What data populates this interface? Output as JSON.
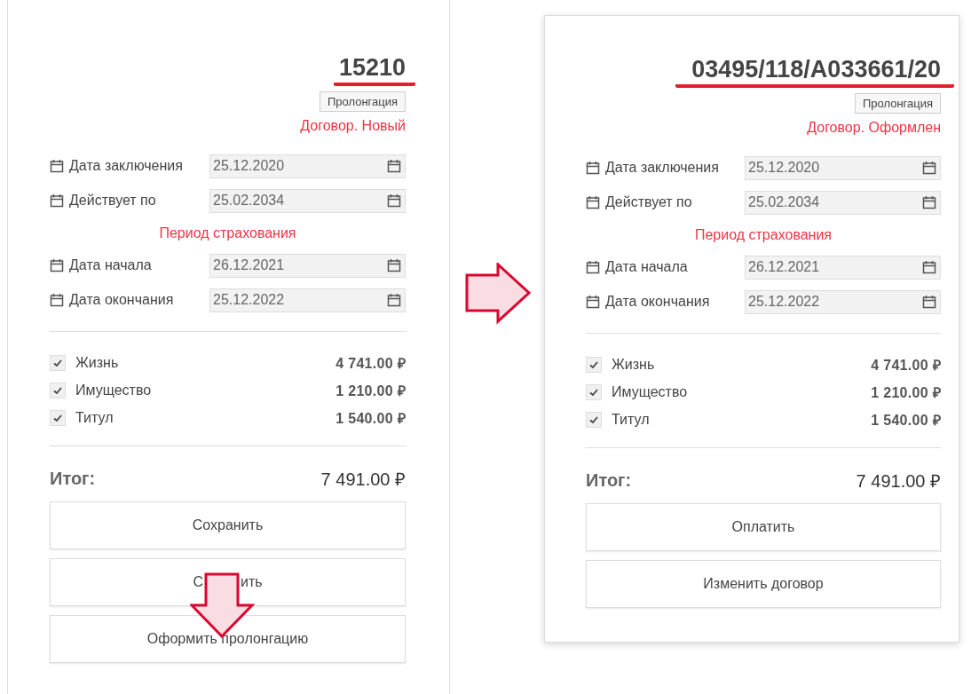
{
  "cards": [
    {
      "number": "15210",
      "tag": "Пролонгация",
      "status": "Договор. Новый",
      "dates": [
        {
          "label": "Дата заключения",
          "value": "25.12.2020"
        },
        {
          "label": "Действует по",
          "value": "25.02.2034"
        }
      ],
      "period_title": "Период страхования",
      "period_dates": [
        {
          "label": "Дата начала",
          "value": "26.12.2021"
        },
        {
          "label": "Дата окончания",
          "value": "25.12.2022"
        }
      ],
      "coverages": [
        {
          "label": "Жизнь",
          "amount": "4 741.00 ₽",
          "checked": true
        },
        {
          "label": "Имущество",
          "amount": "1 210.00 ₽",
          "checked": true
        },
        {
          "label": "Титул",
          "amount": "1 540.00 ₽",
          "checked": true
        }
      ],
      "total_label": "Итог:",
      "total": "7 491.00 ₽",
      "buttons": [
        {
          "label_parts": [
            "Сохранить"
          ]
        },
        {
          "label_parts": [
            "С",
            "ить"
          ]
        },
        {
          "label_parts": [
            "Оформить пролонгацию"
          ]
        }
      ]
    },
    {
      "number": "03495/118/A033661/20",
      "tag": "Пролонгация",
      "status": "Договор. Оформлен",
      "dates": [
        {
          "label": "Дата заключения",
          "value": "25.12.2020"
        },
        {
          "label": "Действует по",
          "value": "25.02.2034"
        }
      ],
      "period_title": "Период страхования",
      "period_dates": [
        {
          "label": "Дата начала",
          "value": "26.12.2021"
        },
        {
          "label": "Дата окончания",
          "value": "25.12.2022"
        }
      ],
      "coverages": [
        {
          "label": "Жизнь",
          "amount": "4 741.00 ₽",
          "checked": true
        },
        {
          "label": "Имущество",
          "amount": "1 210.00 ₽",
          "checked": true
        },
        {
          "label": "Титул",
          "amount": "1 540.00 ₽",
          "checked": true
        }
      ],
      "total_label": "Итог:",
      "total": "7 491.00 ₽",
      "buttons": [
        {
          "label_parts": [
            "Оплатить"
          ]
        },
        {
          "label_parts": [
            "Изменить договор"
          ]
        }
      ]
    }
  ]
}
